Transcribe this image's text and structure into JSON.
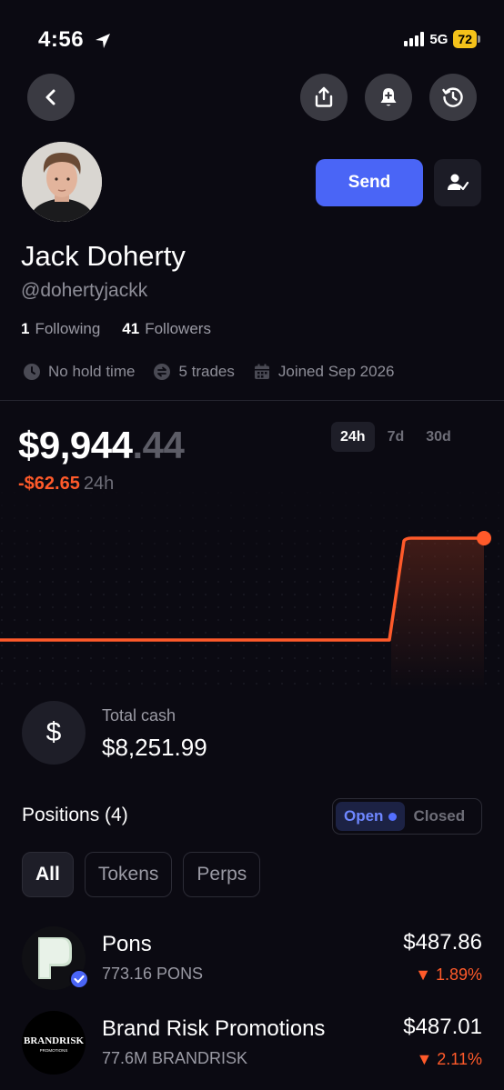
{
  "status": {
    "time": "4:56",
    "network": "5G",
    "battery": "72"
  },
  "header": {
    "back_icon": "chevron-left-icon",
    "share_icon": "share-icon",
    "notify_icon": "bell-plus-icon",
    "history_icon": "history-icon"
  },
  "profile": {
    "name": "Jack Doherty",
    "handle": "@dohertyjackk",
    "following_count": "1",
    "following_label": "Following",
    "followers_count": "41",
    "followers_label": "Followers",
    "send_label": "Send",
    "hold_time": "No hold time",
    "trades": "5 trades",
    "joined": "Joined Sep 2026"
  },
  "portfolio": {
    "balance_main": "$9,944",
    "balance_cents": ".44",
    "change": "-$62.65",
    "change_period": "24h",
    "ranges": [
      "24h",
      "7d",
      "30d"
    ],
    "active_range": "24h",
    "accent_color": "#ff5a2a"
  },
  "cash": {
    "label": "Total cash",
    "value": "$8,251.99",
    "icon": "$"
  },
  "positions": {
    "title": "Positions (4)",
    "open_label": "Open",
    "closed_label": "Closed",
    "filters": [
      "All",
      "Tokens",
      "Perps"
    ],
    "items": [
      {
        "name": "Pons",
        "qty": "773.16 PONS",
        "value": "$487.86",
        "change": "▼ 1.89%"
      },
      {
        "name": "Brand Risk Promotions",
        "qty": "77.6M BRANDRISK",
        "value": "$487.01",
        "change": "▼ 2.11%",
        "logo_text": "BRANDRISK",
        "logo_subtext": "PROMOTIONS"
      }
    ]
  }
}
